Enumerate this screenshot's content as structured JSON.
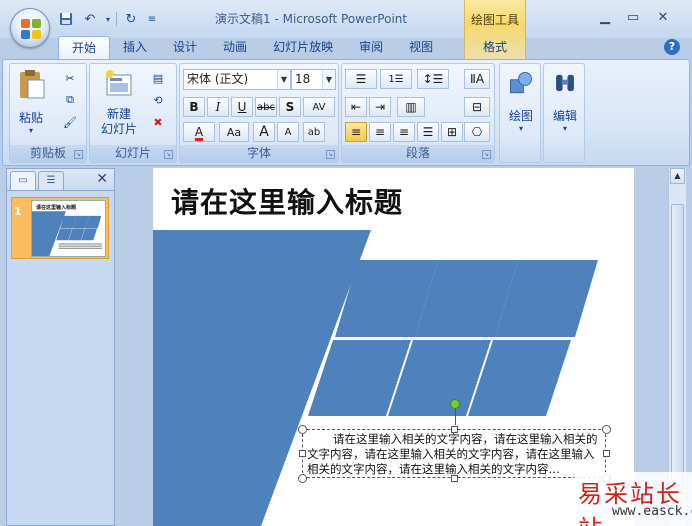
{
  "window": {
    "title": "演示文稿1 - Microsoft PowerPoint",
    "context_tools_label": "绘图工具",
    "controls": [
      "minimize",
      "maximize",
      "close"
    ]
  },
  "quick_access": [
    "save-icon",
    "undo-icon",
    "redo-icon",
    "customize-icon"
  ],
  "tabs": [
    {
      "label": "开始",
      "active": true
    },
    {
      "label": "插入",
      "active": false
    },
    {
      "label": "设计",
      "active": false
    },
    {
      "label": "动画",
      "active": false
    },
    {
      "label": "幻灯片放映",
      "active": false
    },
    {
      "label": "审阅",
      "active": false
    },
    {
      "label": "视图",
      "active": false
    }
  ],
  "format_tab": "格式",
  "help": "?",
  "ribbon": {
    "clipboard": {
      "label": "剪贴板",
      "paste": "粘贴"
    },
    "slides": {
      "label": "幻灯片",
      "new_slide": "新建\n幻灯片"
    },
    "font": {
      "label": "字体",
      "font_name": "宋体 (正文)",
      "font_size": "18",
      "bold": "B",
      "italic": "I",
      "underline": "U",
      "strike": "abc",
      "shadow": "S",
      "spacing": "AV",
      "font_color": "A",
      "change_case": "Aa",
      "grow": "A",
      "shrink": "A",
      "clear": "ab"
    },
    "paragraph": {
      "label": "段落"
    },
    "drawing": {
      "label": "绘图"
    },
    "editing": {
      "label": "编辑"
    }
  },
  "left_pane": {
    "slide_number": "1",
    "thumb_title": "请在这里输入标题"
  },
  "slide": {
    "title": "请在这里输入标题",
    "body_text": "请在这里输入相关的文字内容，请在这里输入相关的文字内容，请在这里输入相关的文字内容，请在这里输入相关的文字内容，请在这里输入相关的文字内容…",
    "shape_color": "#4f81bd"
  },
  "watermark": {
    "cn": "易采站长站",
    "en": "www.easck.com"
  }
}
